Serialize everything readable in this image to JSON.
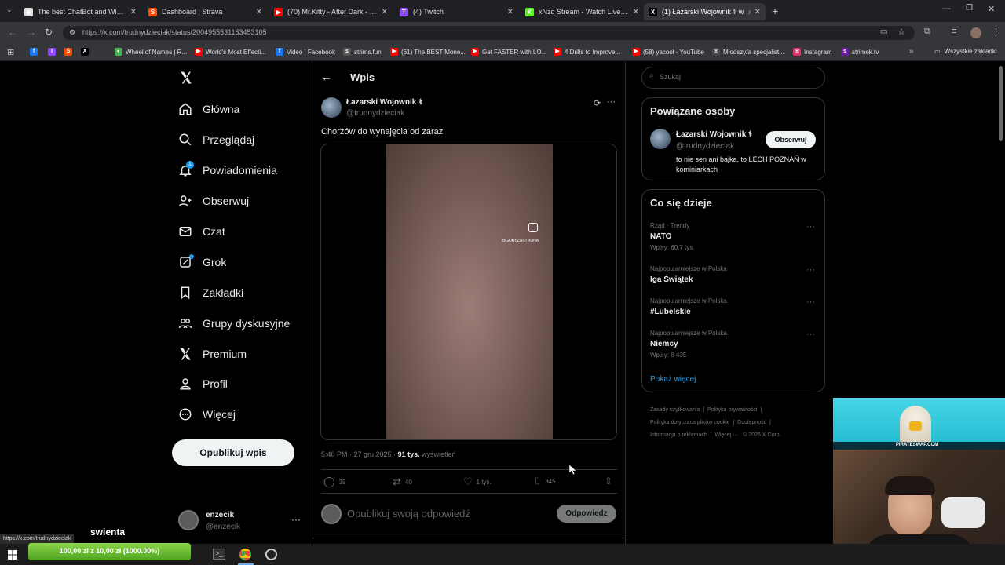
{
  "tabs": [
    {
      "title": "The best ChatBot and Widgets",
      "color": "#e0e0e0",
      "glyph": "◆"
    },
    {
      "title": "Dashboard | Strava",
      "color": "#fc4c02",
      "glyph": "S"
    },
    {
      "title": "(70) Mr.Kitty - After Dark - You",
      "color": "#ff0000",
      "glyph": "▶"
    },
    {
      "title": "(4) Twitch",
      "color": "#9146ff",
      "glyph": "T"
    },
    {
      "title": "xNzq Stream - Watch Live on K",
      "color": "#53fc18",
      "glyph": "K"
    },
    {
      "title": "(1) Łazarski Wojownik ⚕︎ w",
      "color": "#000000",
      "glyph": "X"
    }
  ],
  "browser": {
    "url": "https://x.com/trudnydzieciak/status/2004955531153453105",
    "all_bookmarks": "Wszystkie zakładki"
  },
  "bookmarks": [
    {
      "label": "",
      "color": "#1877f2",
      "glyph": "f"
    },
    {
      "label": "",
      "color": "#9146ff",
      "glyph": "T"
    },
    {
      "label": "",
      "color": "#fc4c02",
      "glyph": "S"
    },
    {
      "label": "",
      "color": "#000000",
      "glyph": "X"
    },
    {
      "label": "Wheel of Names | R...",
      "color": "#4caf50",
      "glyph": "◐"
    },
    {
      "label": "World's Most Effecti...",
      "color": "#ff0000",
      "glyph": "▶"
    },
    {
      "label": "Video | Facebook",
      "color": "#1877f2",
      "glyph": "f"
    },
    {
      "label": "strims.fun",
      "color": "#555555",
      "glyph": "s"
    },
    {
      "label": "(61) The BEST Mone...",
      "color": "#ff0000",
      "glyph": "▶"
    },
    {
      "label": "Get FASTER with LO...",
      "color": "#ff0000",
      "glyph": "▶"
    },
    {
      "label": "4 Drills to Improve...",
      "color": "#ff0000",
      "glyph": "▶"
    },
    {
      "label": "(58) yacool - YouTube",
      "color": "#ff0000",
      "glyph": "▶"
    },
    {
      "label": "Młodszy/a specjalist...",
      "color": "#444444",
      "glyph": "◎"
    },
    {
      "label": "Instagram",
      "color": "#e1306c",
      "glyph": "◎"
    },
    {
      "label": "strimek.tv",
      "color": "#6a1b9a",
      "glyph": "s"
    }
  ],
  "nav": {
    "home": "Główna",
    "explore": "Przeglądaj",
    "notifications": "Powiadomienia",
    "notif_badge": "1",
    "follow": "Obserwuj",
    "chat": "Czat",
    "grok": "Grok",
    "bookmarks": "Zakładki",
    "communities": "Grupy dyskusyjne",
    "premium": "Premium",
    "profile": "Profil",
    "more": "Więcej",
    "post_button": "Opublikuj wpis"
  },
  "account": {
    "name": "enzecik",
    "handle": "@enzecik"
  },
  "post": {
    "header": "Wpis",
    "author_name": "Łazarski Wojownik ⚕︎",
    "author_handle": "@trudnydzieciak",
    "text": "Chorzów do wynajęcia od zaraz",
    "watermark": "@GORSZASTRONA",
    "time": "5:40 PM · 27 gru 2025 · ",
    "views_count": "91 tys.",
    "views_label": " wyświetleń",
    "replies": "39",
    "reposts": "40",
    "likes": "1 tys.",
    "bookmarks": "345",
    "reply_placeholder": "Opublikuj swoją odpowiedź",
    "reply_button": "Odpowiedz"
  },
  "search": {
    "placeholder": "Szukaj"
  },
  "related": {
    "title": "Powiązane osoby",
    "name": "Łazarski Wojownik ⚕︎",
    "handle": "@trudnydzieciak",
    "bio": "to nie sen ani bajka, to LECH POZNAŃ w kominiarkach",
    "follow_button": "Obserwuj"
  },
  "trends": {
    "title": "Co się dzieje",
    "items": [
      {
        "context": "Rząd · Trendy",
        "name": "NATO",
        "count": "Wpisy: 60,7 tys."
      },
      {
        "context": "Najpopularniejsze w Polska",
        "name": "Iga Świątek",
        "count": ""
      },
      {
        "context": "Najpopularniejsze w Polska",
        "name": "#Lubelskie",
        "count": ""
      },
      {
        "context": "Najpopularniejsze w Polska",
        "name": "Niemcy",
        "count": "Wpisy: 8 435"
      }
    ],
    "show_more": "Pokaż więcej"
  },
  "footer": {
    "l1": "Zasady użytkowania",
    "l2": "Polityka prywatności",
    "l3": "Polityka dotycząca plików cookie",
    "l4": "Dostępność",
    "l5": "Informacja o reklamach",
    "l6": "Więcej ···",
    "copyright": "© 2025 X Corp."
  },
  "overlay": {
    "status_url": "https://x.com/trudnydzieciak",
    "stream_word": "swienta",
    "donation_bar": "100,00 zł z 10,00 zł (1000.00%)",
    "donation_progress_percent": 100,
    "ad_text": "PIRATESWAP.COM"
  }
}
